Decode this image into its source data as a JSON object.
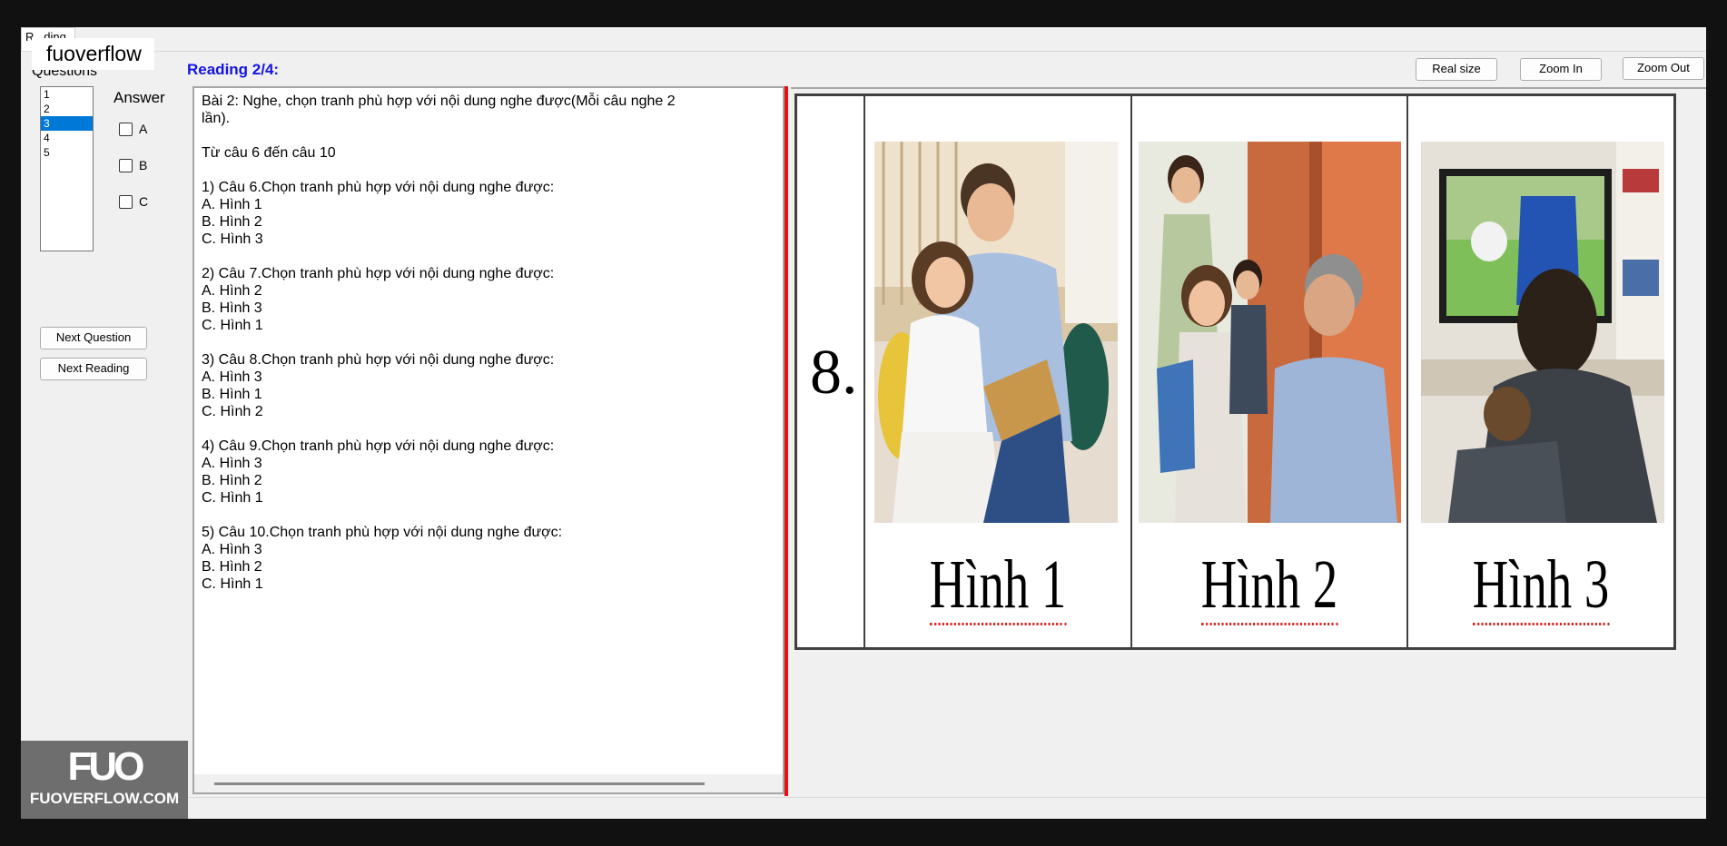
{
  "window": {
    "tab_label": "R...ding",
    "brand_label": "fuoverflow"
  },
  "sidebar": {
    "questions_label": "Questions",
    "list_items": [
      "1",
      "2",
      "3",
      "4",
      "5"
    ],
    "selected_index": 2,
    "answer_label": "Answer",
    "options": [
      "A",
      "B",
      "C"
    ],
    "next_question_label": "Next Question",
    "next_reading_label": "Next Reading"
  },
  "header": {
    "reading_title": "Reading 2/4:"
  },
  "toolbar": {
    "real_size_label": "Real size",
    "zoom_in_label": "Zoom In",
    "zoom_out_label": "Zoom Out"
  },
  "reading_text": {
    "lines": [
      "Bài 2: Nghe, chọn tranh phù hợp với nội dung nghe được(Mỗi câu nghe 2",
      "lần).",
      "",
      "Từ câu 6 đến câu 10",
      "",
      "1) Câu 6.Chọn tranh phù hợp với nội dung nghe được:",
      "A.  Hình 1",
      "B.  Hình 2",
      "C.  Hình 3",
      "",
      "2) Câu 7.Chọn tranh phù hợp với nội dung nghe được:",
      "A.  Hình 2",
      "B.  Hình 3",
      "C.  Hình 1",
      "",
      "3) Câu 8.Chọn tranh phù hợp với nội dung nghe được:",
      "A.  Hình 3",
      "B.  Hình 1",
      "C.  Hình 2",
      "",
      "4) Câu 9.Chọn tranh phù hợp với nội dung nghe được:",
      "A.  Hình 3",
      "B.  Hình 2",
      "C.  Hình 1",
      "",
      "5) Câu 10.Chọn tranh phù hợp với nội dung nghe được:",
      "A.  Hình 3",
      "B.  Hình 2",
      "C.  Hình 1"
    ]
  },
  "image": {
    "number_label": "8.",
    "captions": [
      "Hình 1",
      "Hình 2",
      "Hình 3"
    ]
  },
  "watermark": {
    "logo": "FUO",
    "url": "FUOVERFLOW.COM"
  },
  "colors": {
    "title_blue": "#1414e0",
    "selection_blue": "#0078d7",
    "splitter_red": "#e81010"
  }
}
